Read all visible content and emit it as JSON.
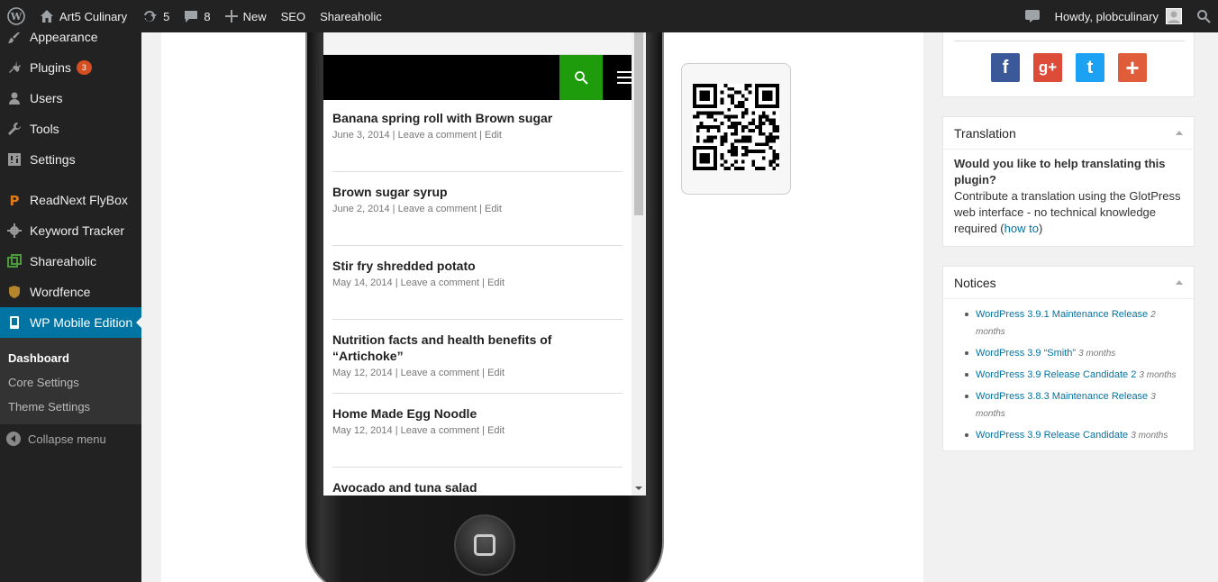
{
  "adminbar": {
    "site_name": "Art5 Culinary",
    "updates_count": "5",
    "comments_count": "8",
    "new_label": "New",
    "seo_label": "SEO",
    "shareaholic_label": "Shareaholic",
    "howdy": "Howdy, plobculinary"
  },
  "sidebar": {
    "items": [
      {
        "label": "Appearance",
        "icon": "paintbrush-icon"
      },
      {
        "label": "Plugins",
        "icon": "plugin-icon",
        "badge": "3"
      },
      {
        "label": "Users",
        "icon": "users-icon"
      },
      {
        "label": "Tools",
        "icon": "wrench-icon"
      },
      {
        "label": "Settings",
        "icon": "settings-icon"
      },
      {
        "label": "ReadNext FlyBox",
        "icon": "readnext-icon"
      },
      {
        "label": "Keyword Tracker",
        "icon": "gear-icon"
      },
      {
        "label": "Shareaholic",
        "icon": "shareaholic-icon"
      },
      {
        "label": "Wordfence",
        "icon": "wordfence-icon"
      },
      {
        "label": "WP Mobile Edition",
        "icon": "mobile-icon"
      }
    ],
    "submenu": [
      "Dashboard",
      "Core Settings",
      "Theme Settings"
    ],
    "collapse_label": "Collapse menu"
  },
  "phone": {
    "posts": [
      {
        "title": "Banana spring roll with Brown sugar",
        "date": "June 3, 2014",
        "comment": "Leave a comment",
        "edit": "Edit"
      },
      {
        "title": "Brown sugar syrup",
        "date": "June 2, 2014",
        "comment": "Leave a comment",
        "edit": "Edit"
      },
      {
        "title": "Stir fry shredded potato",
        "date": "May 14, 2014",
        "comment": "Leave a comment",
        "edit": "Edit"
      },
      {
        "title": "Nutrition facts and health benefits of “Artichoke”",
        "date": "May 12, 2014",
        "comment": "Leave a comment",
        "edit": "Edit"
      },
      {
        "title": "Home Made Egg Noodle",
        "date": "May 12, 2014",
        "comment": "Leave a comment",
        "edit": "Edit"
      },
      {
        "title": "Avocado and tuna salad",
        "date": "",
        "comment": "",
        "edit": ""
      }
    ],
    "accent": "#1e9c0b"
  },
  "translation": {
    "title": "Translation",
    "line1": "Would you like to help translating this plugin?",
    "line2": "Contribute a translation using the GlotPress web interface - no technical knowledge required (",
    "link": "how to",
    "line2_end": ")"
  },
  "notices": {
    "title": "Notices",
    "items": [
      {
        "link": "WordPress 3.9.1 Maintenance Release",
        "age": "2 months"
      },
      {
        "link": "WordPress 3.9 “Smith”",
        "age": "3 months"
      },
      {
        "link": "WordPress 3.9 Release Candidate 2",
        "age": "3 months"
      },
      {
        "link": "WordPress 3.8.3 Maintenance Release",
        "age": "3 months"
      },
      {
        "link": "WordPress 3.9 Release Candidate",
        "age": "3 months"
      }
    ]
  },
  "social": {
    "facebook": "f",
    "googleplus": "g+",
    "twitter": "t",
    "more": "+",
    "colors": {
      "facebook": "#3b5998",
      "googleplus": "#dd4b39",
      "twitter": "#1da1f2",
      "more": "#e05d3c"
    }
  },
  "colors": {
    "admin_bg": "#222222",
    "admin_active": "#0074a2",
    "link": "#0074a2"
  }
}
